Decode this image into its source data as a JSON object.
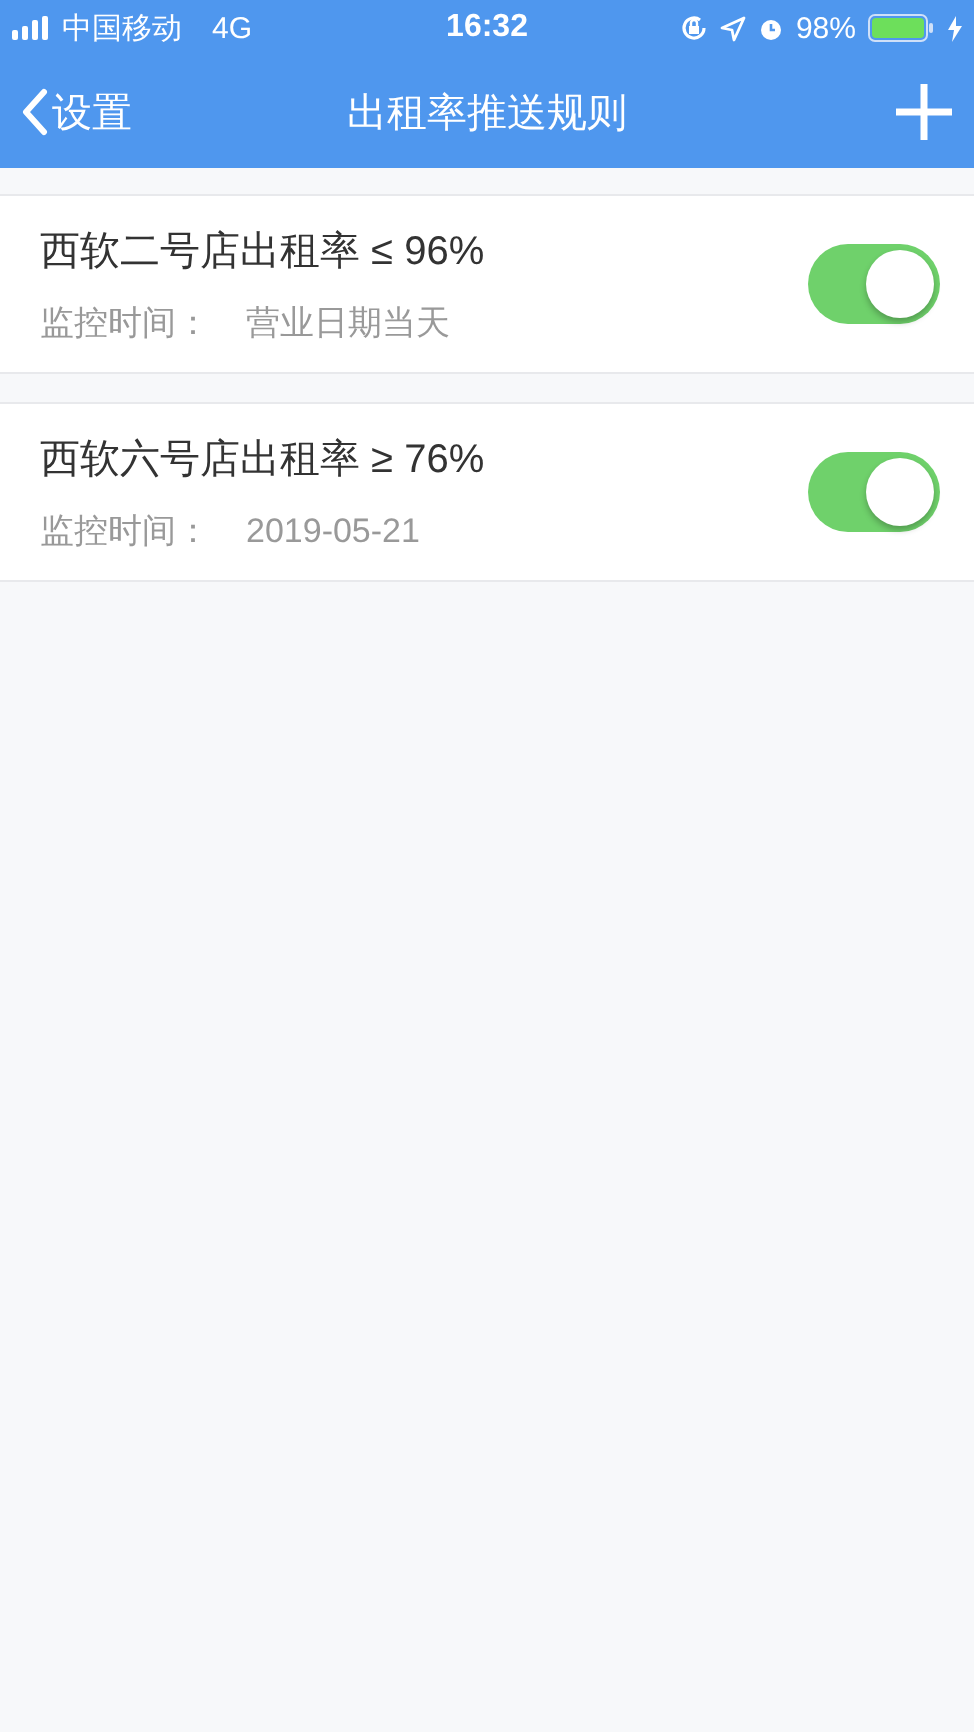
{
  "status_bar": {
    "carrier": "中国移动",
    "network": "4G",
    "time": "16:32",
    "battery": "98%"
  },
  "nav_bar": {
    "back_label": "设置",
    "title": "出租率推送规则"
  },
  "rules": [
    {
      "title": "西软二号店出租率 ≤ 96%",
      "time_label": "监控时间：",
      "time_value": "营业日期当天",
      "on": true
    },
    {
      "title": "西软六号店出租率 ≥ 76%",
      "time_label": "监控时间：",
      "time_value": "2019-05-21",
      "on": true
    }
  ]
}
